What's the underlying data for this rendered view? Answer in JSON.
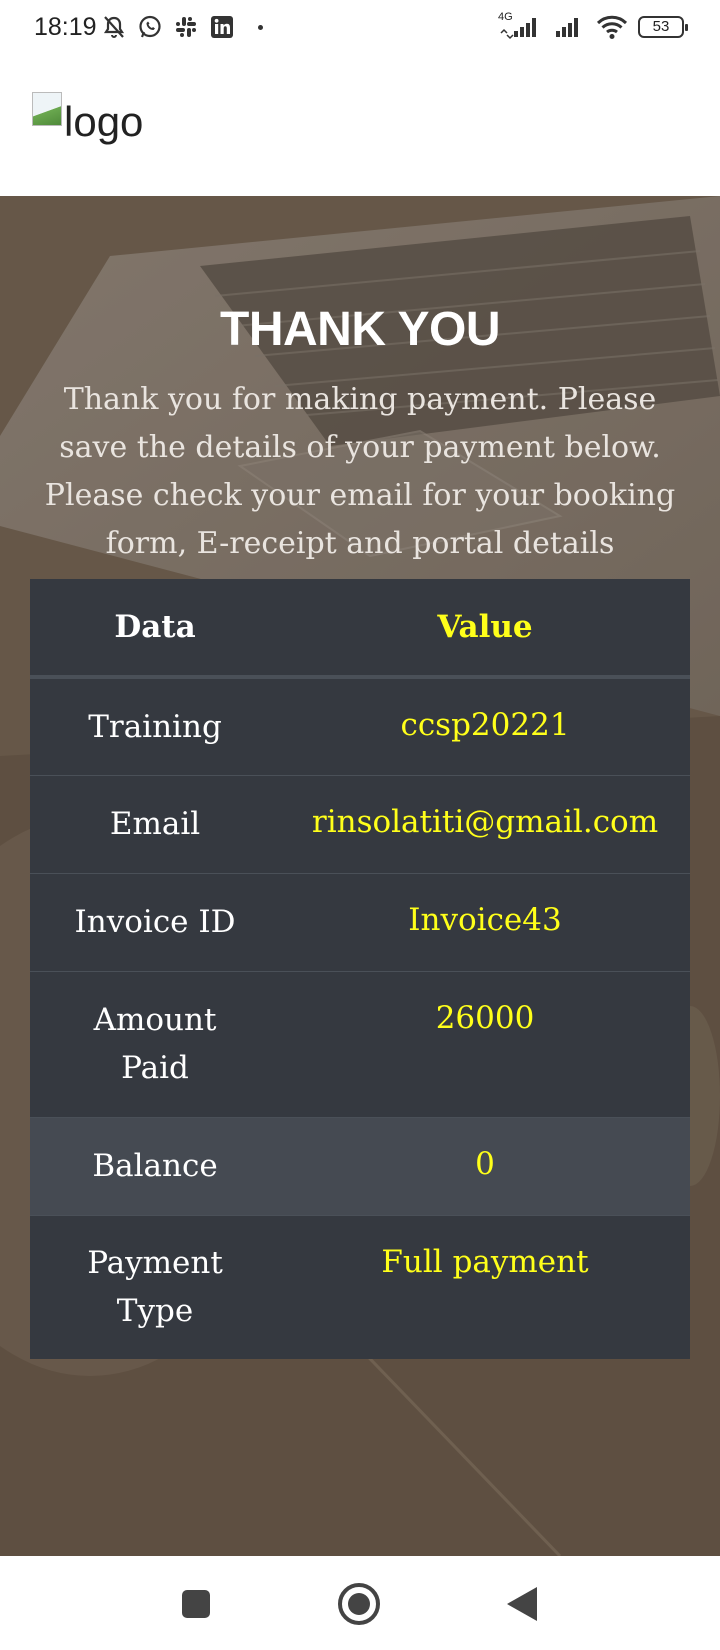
{
  "status_bar": {
    "time": "18:19",
    "battery": "53",
    "network": "4G",
    "left_icons": [
      "mute-icon",
      "whatsapp-icon",
      "slack-icon",
      "linkedin-icon"
    ],
    "right_icons": [
      "signal-4g-icon",
      "signal-icon",
      "wifi-icon",
      "battery-icon"
    ]
  },
  "header": {
    "logo_alt": "logo"
  },
  "hero": {
    "title": "THANK YOU",
    "message": "Thank you for making payment. Please save the details of your payment below. Please check your email for your booking form, E-receipt and portal details"
  },
  "table": {
    "headers": {
      "data": "Data",
      "value": "Value"
    },
    "rows": [
      {
        "label": "Training",
        "value": "ccsp20221"
      },
      {
        "label": "Email",
        "value": "rinsolatiti@gmail.com"
      },
      {
        "label": "Invoice ID",
        "value": "Invoice43"
      },
      {
        "label": "Amount Paid",
        "value": "26000"
      },
      {
        "label": "Balance",
        "value": "0"
      },
      {
        "label": "Payment Type",
        "value": "Full payment"
      }
    ]
  },
  "nav_bar": {
    "buttons": [
      "recents-button",
      "home-button",
      "back-button"
    ]
  },
  "colors": {
    "value_text": "#ffff1a",
    "table_bg": "#353940",
    "table_alt_bg": "#454a52",
    "hero_overlay": "#6e6052"
  }
}
